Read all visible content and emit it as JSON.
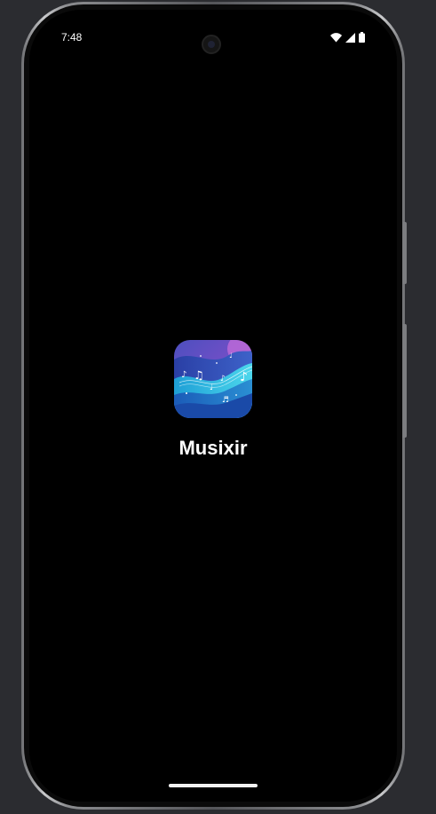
{
  "status_bar": {
    "time": "7:48",
    "icons": [
      "wifi-icon",
      "cellular-signal-icon",
      "battery-icon"
    ]
  },
  "splash": {
    "app_icon": "musixir-app-icon",
    "app_name": "Musixir"
  },
  "colors": {
    "screen_background": "#000000",
    "text": "#ffffff",
    "icon_top": "#6a55c8",
    "icon_wave": "#2fb7df",
    "icon_bottom": "#1a4aa8"
  }
}
